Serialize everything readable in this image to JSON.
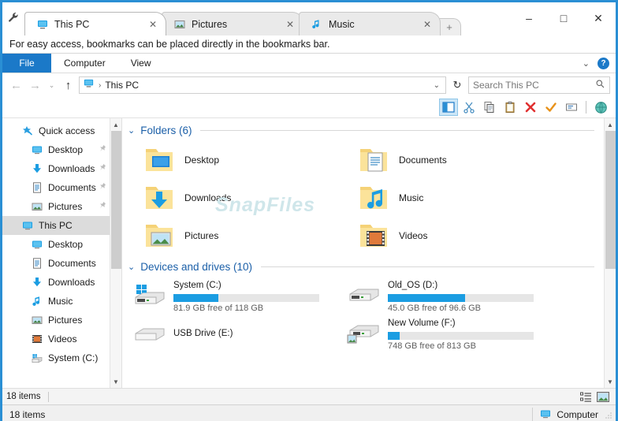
{
  "window": {
    "wrench_icon": "wrench-icon",
    "minimize_label": "–",
    "maximize_label": "□",
    "close_label": "✕",
    "frame_color": "#2a8fd4"
  },
  "tabs": [
    {
      "label": "This PC",
      "icon": "monitor-icon",
      "close": "✕",
      "active": true
    },
    {
      "label": "Pictures",
      "icon": "picture-icon",
      "close": "✕",
      "active": false
    },
    {
      "label": "Music",
      "icon": "music-note-icon",
      "close": "✕",
      "active": false
    }
  ],
  "new_tab_label": "+",
  "bookmarks_bar": {
    "message": "For easy access, bookmarks can be placed directly in the bookmarks bar."
  },
  "ribbon": {
    "tabs": [
      {
        "label": "File",
        "accent": true
      },
      {
        "label": "Computer",
        "accent": false
      },
      {
        "label": "View",
        "accent": false
      }
    ],
    "expand_chevron": "⌄",
    "help_label": "?"
  },
  "address": {
    "back": "←",
    "forward": "→",
    "recent": "⌄",
    "up": "↑",
    "icon": "monitor-icon",
    "separator": "›",
    "crumb": "This PC",
    "dropdown": "⌄",
    "refresh": "↻"
  },
  "search": {
    "placeholder": "Search This PC",
    "icon": "search-icon"
  },
  "toolbar": {
    "buttons": [
      {
        "name": "navigation-pane-toggle",
        "glyph": "pane",
        "selected": true
      },
      {
        "name": "cut-button",
        "glyph": "scissors",
        "selected": false
      },
      {
        "name": "copy-button",
        "glyph": "copy",
        "selected": false
      },
      {
        "name": "paste-button",
        "glyph": "clipboard",
        "selected": false
      },
      {
        "name": "delete-button",
        "glyph": "redx",
        "selected": false
      },
      {
        "name": "confirm-button",
        "glyph": "check",
        "selected": false
      },
      {
        "name": "rename-button",
        "glyph": "rename",
        "selected": false
      },
      {
        "name": "internet-button",
        "glyph": "globe",
        "selected": false
      }
    ]
  },
  "sidebar": {
    "items": [
      {
        "label": "Quick access",
        "icon": "star-pin-icon",
        "level": "root",
        "pinned": false,
        "selected": false
      },
      {
        "label": "Desktop",
        "icon": "monitor-icon",
        "level": "child",
        "pinned": true,
        "selected": false
      },
      {
        "label": "Downloads",
        "icon": "download-icon",
        "level": "child",
        "pinned": true,
        "selected": false
      },
      {
        "label": "Documents",
        "icon": "document-icon",
        "level": "child",
        "pinned": true,
        "selected": false
      },
      {
        "label": "Pictures",
        "icon": "picture-icon",
        "level": "child",
        "pinned": true,
        "selected": false
      },
      {
        "label": "This PC",
        "icon": "monitor-icon",
        "level": "root",
        "pinned": false,
        "selected": true
      },
      {
        "label": "Desktop",
        "icon": "monitor-icon",
        "level": "child",
        "pinned": false,
        "selected": false
      },
      {
        "label": "Documents",
        "icon": "document-icon",
        "level": "child",
        "pinned": false,
        "selected": false
      },
      {
        "label": "Downloads",
        "icon": "download-icon",
        "level": "child",
        "pinned": false,
        "selected": false
      },
      {
        "label": "Music",
        "icon": "music-note-icon",
        "level": "child",
        "pinned": false,
        "selected": false
      },
      {
        "label": "Pictures",
        "icon": "picture-icon",
        "level": "child",
        "pinned": false,
        "selected": false
      },
      {
        "label": "Videos",
        "icon": "video-icon",
        "level": "child",
        "pinned": false,
        "selected": false
      },
      {
        "label": "System (C:)",
        "icon": "drive-windows-icon",
        "level": "child",
        "pinned": false,
        "selected": false
      }
    ]
  },
  "content": {
    "watermark": "SnapFiles",
    "folders_section": {
      "chevron": "⌄",
      "title": "Folders (6)"
    },
    "folders": [
      {
        "label": "Desktop",
        "icon": "folder-desktop-icon"
      },
      {
        "label": "Documents",
        "icon": "folder-documents-icon"
      },
      {
        "label": "Downloads",
        "icon": "folder-downloads-icon"
      },
      {
        "label": "Music",
        "icon": "folder-music-icon"
      },
      {
        "label": "Pictures",
        "icon": "folder-pictures-icon"
      },
      {
        "label": "Videos",
        "icon": "folder-videos-icon"
      }
    ],
    "drives_section": {
      "chevron": "⌄",
      "title": "Devices and drives (10)"
    },
    "drives": [
      {
        "name": "System (C:)",
        "capacity_text": "81.9 GB free of 118 GB",
        "used_percent": 31,
        "has_bar": true,
        "icon": "drive-windows-icon"
      },
      {
        "name": "Old_OS (D:)",
        "capacity_text": "45.0 GB free of 96.6 GB",
        "used_percent": 53,
        "has_bar": true,
        "icon": "drive-icon"
      },
      {
        "name": "USB Drive (E:)",
        "capacity_text": "",
        "used_percent": 0,
        "has_bar": false,
        "icon": "drive-plain-icon"
      },
      {
        "name": "New Volume (F:)",
        "capacity_text": "748 GB free of 813 GB",
        "used_percent": 8,
        "has_bar": true,
        "icon": "drive-photo-icon"
      }
    ]
  },
  "inner_status": {
    "item_count": "18 items",
    "details_view": "details-view-icon",
    "large_icons_view": "large-icons-view-icon"
  },
  "app_status": {
    "item_count": "18 items",
    "location_label": "Computer",
    "location_icon": "monitor-icon"
  }
}
